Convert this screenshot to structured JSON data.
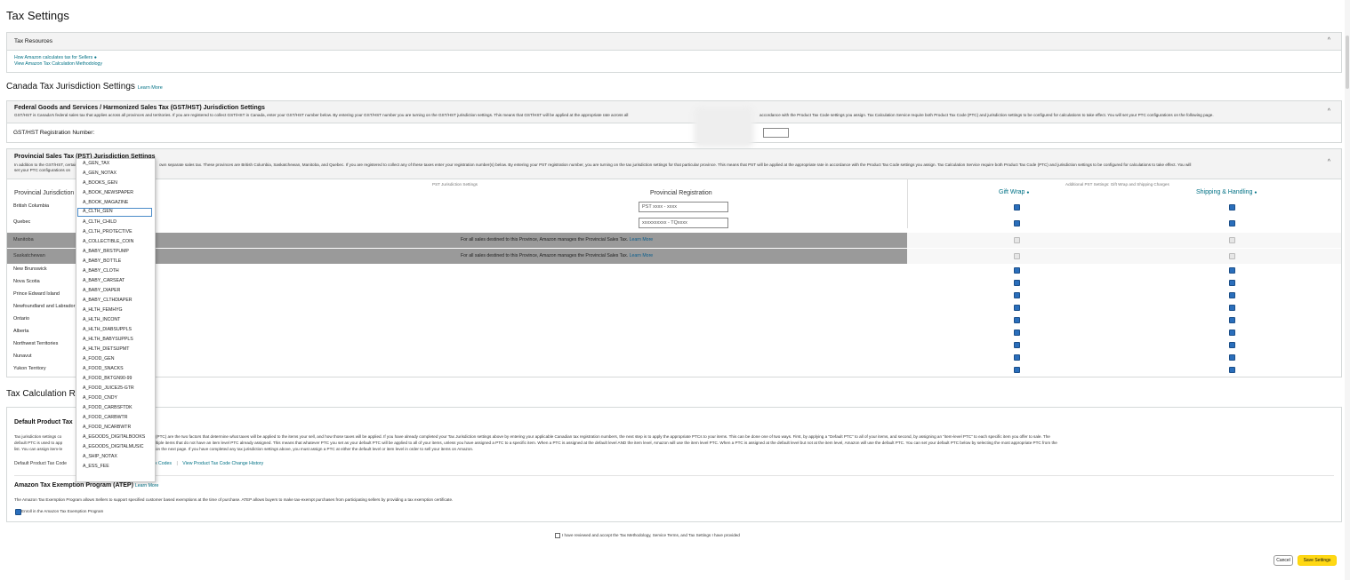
{
  "page": {
    "title": "Tax Settings"
  },
  "tax_resources": {
    "header": "Tax Resources",
    "links": [
      "How Amazon calculates tax for Sellers",
      "View Amazon Tax Calculation Methodology"
    ]
  },
  "canada": {
    "title": "Canada Tax Jurisdiction Settings",
    "learn_more": "Learn More"
  },
  "gst": {
    "title": "Federal Goods and Services / Harmonized Sales Tax (GST/HST) Jurisdiction Settings",
    "desc_left": "GST/HST is Canada's federal sales tax that applies across all provinces and territories. If you are registered to collect GST/HST in Canada, enter your GST/HST number below. By entering your GST/HST number you are turning on the GST/HST jurisdiction settings. This means that GST/HST will be applied at the appropriate rate across all",
    "desc_right": "accordance with the Product Tax Code settings you assign. Tax Calculation Service require both Product Tax Code (PTC) and jurisdiction settings to be configured for calculations to take effect. You will set your PTC configurations on the following page.",
    "reg_label": "GST/HST Registration Number:",
    "reg_value": ""
  },
  "pst": {
    "title": "Provincial Sales Tax (PST) Jurisdiction Settings",
    "desc_left_1": "In addition to the GST/HST, certain",
    "desc_left_2": "set your PTC configurations on",
    "desc_right": "own separate sales tax. These provinces are British Columbia, Saskatchewan, Manitoba, and Quebec. If you are registered to collect any of these taxes enter your registration number(s) below. By entering your PST registration number, you are turning on the tax jurisdiction settings for that particular province. This means that PST will be applied at the appropriate rate in accordance with the Product Tax Code settings you assign. Tax Calculation Service require both Product Tax Code (PTC) and jurisdiction settings to be configured for calculations to take effect. You will",
    "subhead_jurisdiction": "PST Jurisdiction Settings",
    "subhead_additional": "Additional PST Settings: Gift Wrap and Shipping Charges",
    "col_jurisdiction": "Provincial Jurisdiction",
    "col_registration": "Provincial Registration",
    "col_giftwrap": "Gift Wrap",
    "col_shipping": "Shipping & Handling",
    "managed_msg": "For all sales destined to this Province, Amazon manages the Provincial Sales Tax.",
    "managed_link": "Learn More",
    "rows": [
      {
        "name": "British Columbia",
        "reg": "PST xxxx - xxxx",
        "gift": true,
        "ship": true,
        "managed": false
      },
      {
        "name": "Quebec",
        "reg": "xxxxxxxxxx - TQxxxx",
        "gift": true,
        "ship": true,
        "managed": false
      },
      {
        "name": "Manitoba",
        "reg": "",
        "gift": false,
        "ship": false,
        "managed": true
      },
      {
        "name": "Saskatchewan",
        "reg": "",
        "gift": false,
        "ship": false,
        "managed": true
      },
      {
        "name": "New Brunswick",
        "gift": true,
        "ship": true,
        "managed": false
      },
      {
        "name": "Nova Scotia",
        "gift": true,
        "ship": true,
        "managed": false
      },
      {
        "name": "Prince Edward Island",
        "gift": true,
        "ship": true,
        "managed": false
      },
      {
        "name": "Newfoundland and Labrador",
        "gift": true,
        "ship": true,
        "managed": false
      },
      {
        "name": "Ontario",
        "gift": true,
        "ship": true,
        "managed": false
      },
      {
        "name": "Alberta",
        "gift": true,
        "ship": true,
        "managed": false
      },
      {
        "name": "Northwest Territories",
        "gift": true,
        "ship": true,
        "managed": false
      },
      {
        "name": "Nunavut",
        "gift": true,
        "ship": true,
        "managed": false
      },
      {
        "name": "Yukon Territory",
        "gift": true,
        "ship": true,
        "managed": false
      }
    ]
  },
  "tax_calc": {
    "title": "Tax Calculation R",
    "default_ptc_title": "Default Product Tax",
    "desc_l1a": "Tax jurisdiction settings co",
    "desc_l1b": "(PTC) are the two factors that determine what taxes will be applied to the items your sell, and how those taxes will be applied. If you have already completed your Tax Jurisdiction settings above by entering your applicable Canadian tax registration numbers, the next step is to apply the appropriate PTCs to your items. This can be done one of two ways. First, by applying a \"Default PTC\" to all of your items, and second, by assigning an \"item-level PTC\" to each specific item you offer to sale. The",
    "desc_l2a": "default PTC is used to app",
    "desc_l2b": "ltiple items that do not have an item level PTC already assigned. This means that whatever PTC you set as your default PTC will be applied to all of your items, unless you have assigned a PTC to a specific item. When a PTC is assigned at the default level AND the item level, Amazon will use the item level PTC. When a PTC is assigned at the default level but not at the item level, Amazon will use the default PTC. You can set your default PTC below by selecting the most appropriate PTC from the",
    "desc_l3a": "list. You can assign item-le",
    "desc_l3b": "on the next page. If you have completed any tax jurisdiction settings above, you must assign a PTC at either the default level or item level in order to sell your items on Amazon.",
    "default_ptc_label": "Default Product Tax Code",
    "ptc_codes_link": "x Codes",
    "change_history_link": "View Product Tax Code Change History",
    "atep_title": "Amazon Tax Exemption Program (ATEP)",
    "atep_learn": "Learn More",
    "atep_desc": "The Amazon Tax Exemption Program allows Sellers to support specified customer based exemptions at the time of purchase. ATEP allows buyers to make tax-exempt purchases from participating sellers by providing a tax exemption certificate.",
    "atep_enroll": "Enroll in the Amazon Tax Exemption Program",
    "atep_enrolled": true
  },
  "footer": {
    "accept_text": "I have reviewed and accept the Tax Methodology, Service Terms, and Tax Settings I have provided",
    "cancel": "Cancel",
    "save": "Save Settings"
  },
  "ptc_dropdown": {
    "selected": "A_CLTH_GEN",
    "options": [
      "A_GEN_TAX",
      "A_GEN_NOTAX",
      "A_BOOKS_GEN",
      "A_BOOK_NEWSPAPER",
      "A_BOOK_MAGAZINE",
      "A_CLTH_GEN",
      "A_CLTH_CHILD",
      "A_CLTH_PROTECTIVE",
      "A_COLLECTIBLE_COIN",
      "A_BABY_BRSTPUMP",
      "A_BABY_BOTTLE",
      "A_BABY_CLOTH",
      "A_BABY_CARSEAT",
      "A_BABY_DIAPER",
      "A_BABY_CLTHDIAPER",
      "A_HLTH_FEMHYG",
      "A_HLTH_INCONT",
      "A_HLTH_DIABSUPPLS",
      "A_HLTH_BABYSUPPLS",
      "A_HLTH_DIETSUPMT",
      "A_FOOD_GEN",
      "A_FOOD_SNACKS",
      "A_FOOD_BKTGN90-99",
      "A_FOOD_JUICE25-GTR",
      "A_FOOD_CNDY",
      "A_FOOD_CARBSFTDK",
      "A_FOOD_CARBWTR",
      "A_FOOD_NCARBWTR",
      "A_EGOODS_DIGITALBOOKS",
      "A_EGOODS_DIGITALMUSIC",
      "A_SHIP_NOTAX",
      "A_ESS_FEE"
    ]
  },
  "colors": {
    "link": "#007185",
    "save_button": "#ffd814",
    "checkbox": "#2a6ebb",
    "managed_row": "#9a9a9a"
  }
}
